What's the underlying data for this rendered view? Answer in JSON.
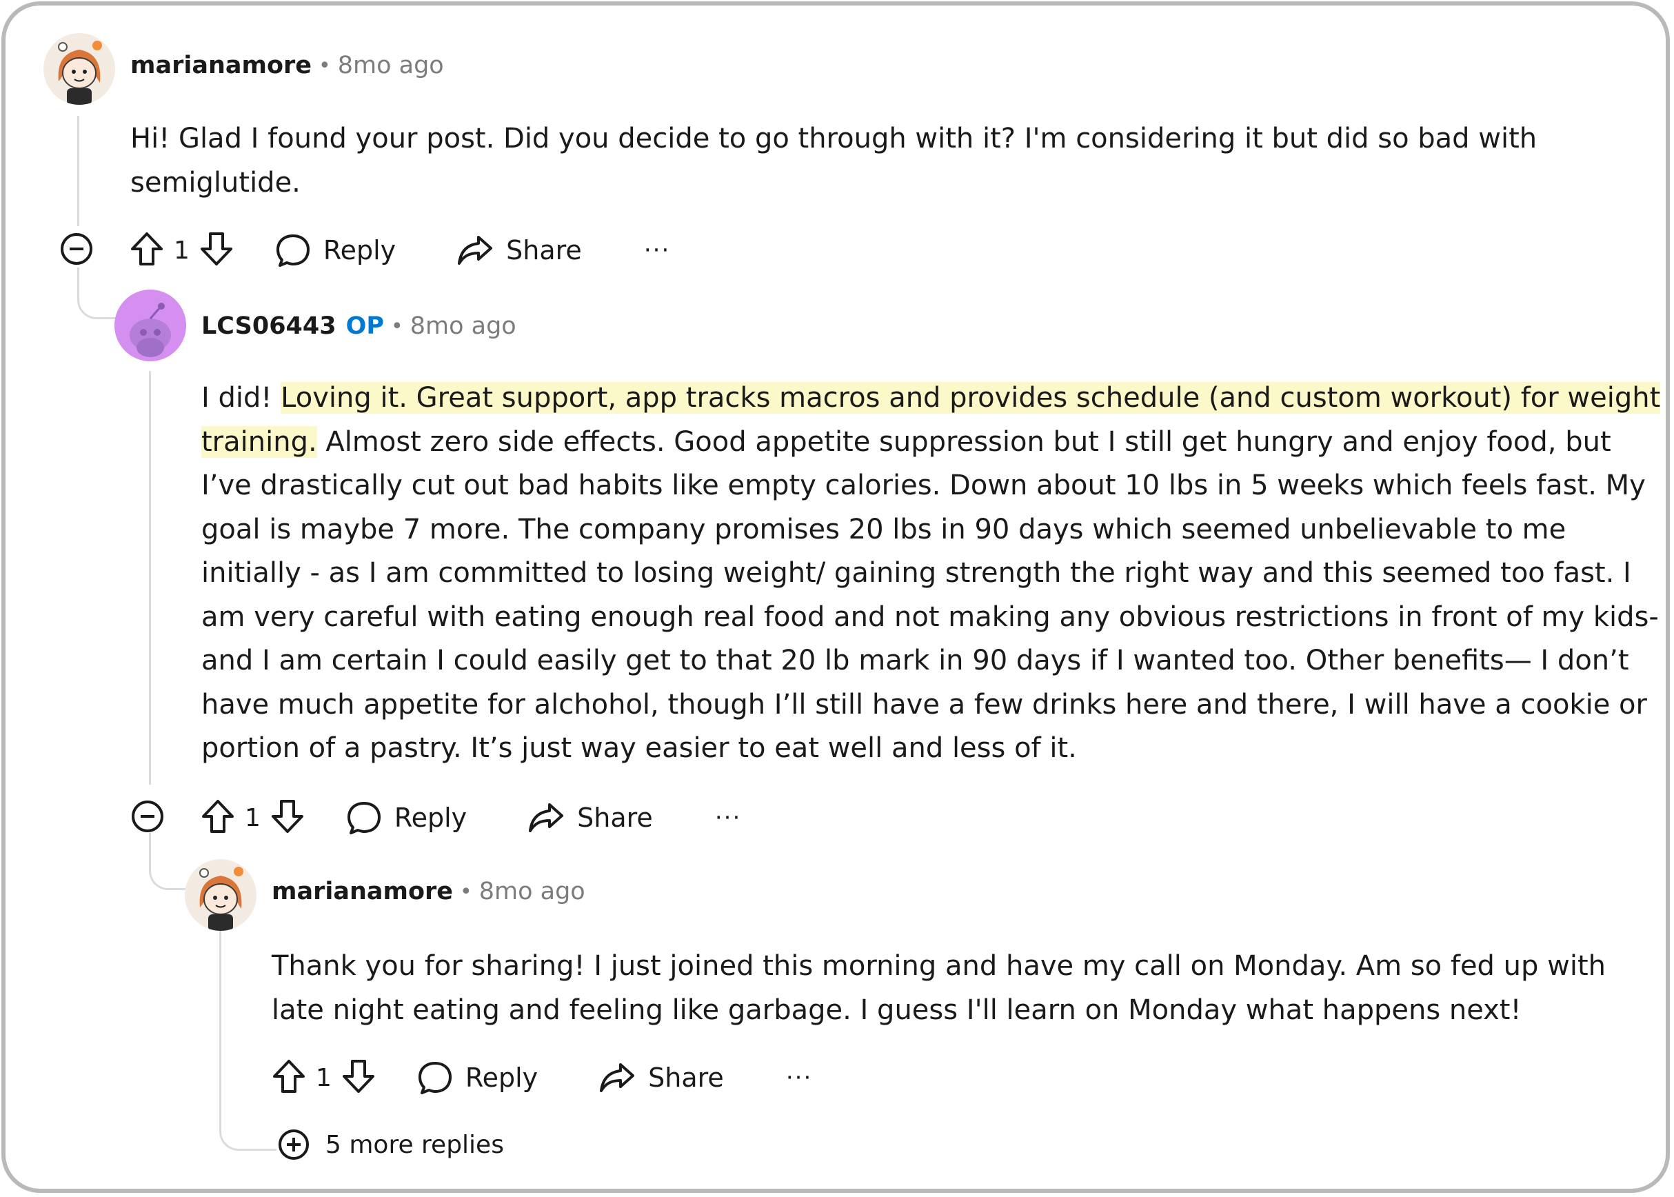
{
  "comments": [
    {
      "username": "marianamore",
      "separator": "•",
      "time": "8mo ago",
      "body": "Hi! Glad I found your post. Did you decide to go through with it? I'm considering it but did so bad with semiglutide.",
      "upvotes": "1",
      "reply_label": "Reply",
      "share_label": "Share",
      "more_label": "···",
      "avatar_icon": "snoo-redhead-avatar-icon"
    },
    {
      "username": "LCS06443",
      "op_badge": "OP",
      "separator": "•",
      "time": "8mo ago",
      "body_before": "I did! ",
      "body_highlight": "Loving it. Great support, app tracks macros and provides schedule (and custom workout) for weight training.",
      "body_after": " Almost zero side effects. Good appetite suppression but I still get hungry and enjoy food, but I’ve drastically cut out bad habits like empty calories. Down about 10 lbs in 5 weeks which feels fast. My goal is maybe 7 more. The company promises 20 lbs in 90 days which seemed unbelievable to me initially - as I am committed to losing weight/ gaining strength the right way and this seemed too fast. I am very careful with eating enough real food and not making any obvious restrictions in front of my kids- and I am certain I could easily get to that 20 lb mark in 90 days if I wanted too. Other benefits— I don’t have much appetite for alchohol, though I’ll still have a few drinks here and there, I will have a cookie or portion of a pastry. It’s just way easier to eat well and less of it.",
      "upvotes": "1",
      "reply_label": "Reply",
      "share_label": "Share",
      "more_label": "···",
      "avatar_icon": "default-snoo-avatar-icon",
      "highlight_color": "#fbf8c9"
    },
    {
      "username": "marianamore",
      "separator": "•",
      "time": "8mo ago",
      "body": "Thank you for sharing! I just joined this morning and have my call on Monday. Am so fed up with late night eating and feeling like garbage. I guess I'll learn on Monday what happens next!",
      "upvotes": "1",
      "reply_label": "Reply",
      "share_label": "Share",
      "more_label": "···",
      "avatar_icon": "snoo-redhead-avatar-icon"
    }
  ],
  "more_replies": "5 more replies",
  "colors": {
    "op_blue": "#0079d3",
    "thread_line": "#d9dcdf",
    "meta_gray": "#7c7c7c",
    "avatar_purple": "#d48ff0"
  }
}
